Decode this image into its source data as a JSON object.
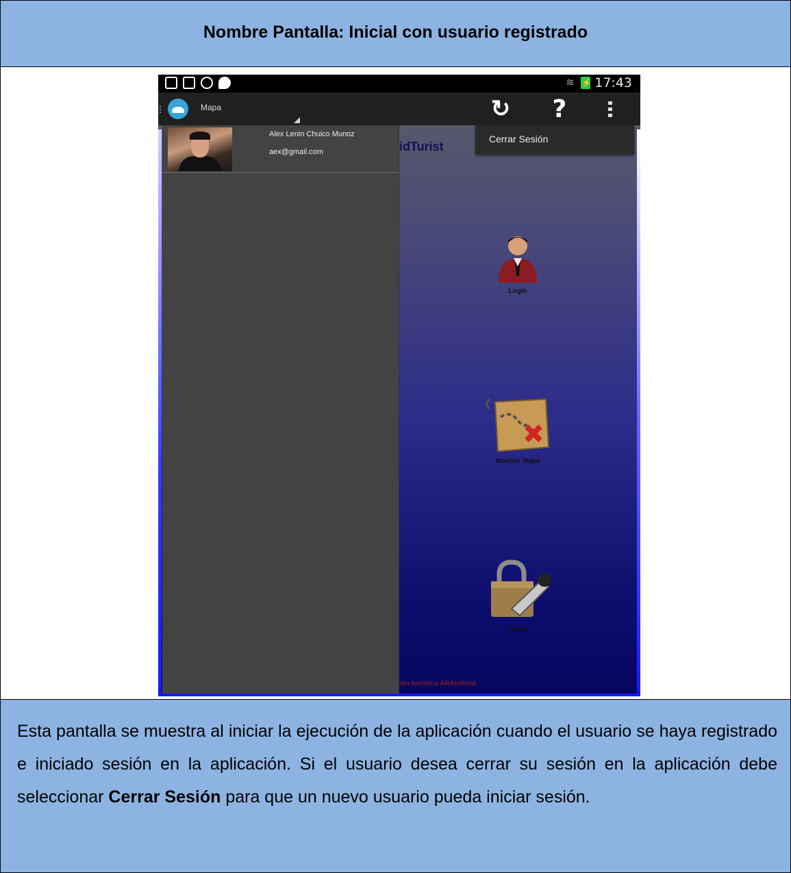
{
  "document": {
    "title": "Nombre Pantalla: Inicial con usuario registrado",
    "description_parts": [
      "Esta pantalla se muestra al iniciar la ejecución de la aplicación cuando el usuario se haya registrado e iniciado sesión en  la aplicación. Si el usuario desea cerrar su sesión en la aplicación debe seleccionar ",
      "Cerrar Sesión",
      " para que un nuevo usuario pueda iniciar sesión."
    ]
  },
  "statusbar": {
    "icons": [
      "gallery-icon",
      "instagram-icon",
      "share-icon",
      "chat-check-icon"
    ],
    "time": "17:43",
    "wifi_glyph": "≋"
  },
  "actionbar": {
    "title": "Mapa",
    "refresh_glyph": "↻",
    "help_glyph": "?"
  },
  "overflow_menu": {
    "items": [
      "Cerrar Sesión"
    ]
  },
  "drawer": {
    "user_name": "Alex Lenin Chuico Munoz",
    "user_email": "aex@gmail.com"
  },
  "main": {
    "app_title_fragment": "idTurist",
    "tiles": [
      {
        "label": "Login",
        "icon": "user-icon"
      },
      {
        "label": "Mostrar Mapa",
        "icon": "treasure-map-icon"
      },
      {
        "label": "Cerrar",
        "icon": "padlock-key-icon"
      }
    ],
    "footer_fragment": "ión turística ARAndroid"
  },
  "colors": {
    "table_header_bg": "#8db3e2",
    "app_gradient_bottom": "#06065e",
    "drawer_bg": "#434343",
    "actionbar_bg": "#202020"
  }
}
